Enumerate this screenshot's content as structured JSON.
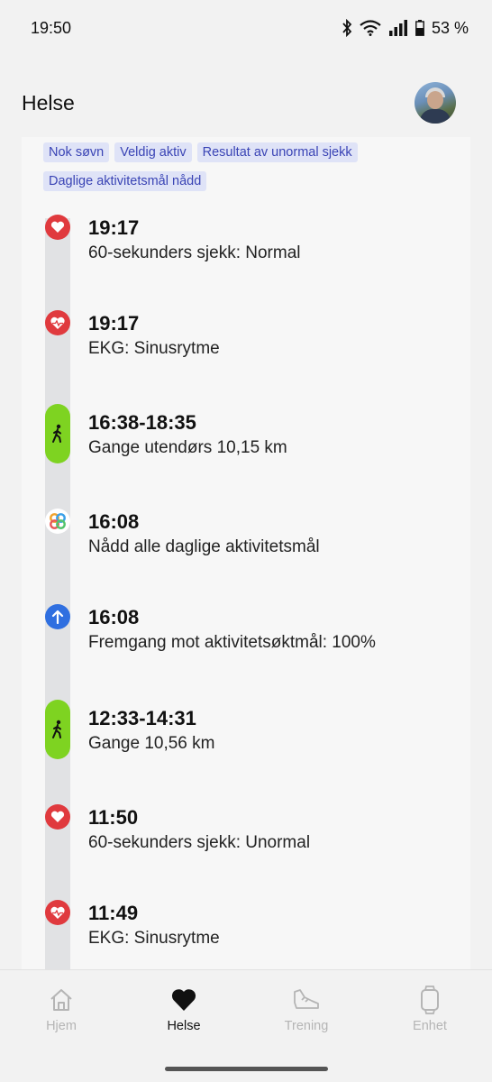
{
  "status_bar": {
    "time": "19:50",
    "battery": "53 %",
    "icons": [
      "bluetooth-icon",
      "wifi-icon",
      "signal-icon",
      "battery-icon"
    ]
  },
  "header": {
    "title": "Helse",
    "avatar": "avatar"
  },
  "tags": [
    "Nok søvn",
    "Veldig aktiv",
    "Resultat av unormal sjekk",
    "Daglige aktivitetsmål nådd"
  ],
  "timeline": [
    {
      "time": "19:17",
      "description": "60-sekunders sjekk: Normal",
      "icon": "heart-icon"
    },
    {
      "time": "19:17",
      "description": "EKG: Sinusrytme",
      "icon": "ecg-heart-icon"
    },
    {
      "time": "16:38-18:35",
      "description": "Gange utendørs 10,15 km",
      "icon": "walk-icon"
    },
    {
      "time": "16:08",
      "description": "Nådd alle daglige aktivitetsmål",
      "icon": "activity-rings-icon"
    },
    {
      "time": "16:08",
      "description": "Fremgang mot aktivitetsøktmål: 100%",
      "icon": "arrow-up-icon"
    },
    {
      "time": "12:33-14:31",
      "description": "Gange 10,56 km",
      "icon": "walk-icon"
    },
    {
      "time": "11:50",
      "description": "60-sekunders sjekk: Unormal",
      "icon": "heart-icon"
    },
    {
      "time": "11:49",
      "description": "EKG: Sinusrytme",
      "icon": "ecg-heart-icon"
    }
  ],
  "bottom_nav": [
    {
      "label": "Hjem",
      "icon": "home-icon",
      "active": false
    },
    {
      "label": "Helse",
      "icon": "heart-icon",
      "active": true
    },
    {
      "label": "Trening",
      "icon": "shoe-icon",
      "active": false
    },
    {
      "label": "Enhet",
      "icon": "watch-icon",
      "active": false
    }
  ],
  "colors": {
    "heart_red": "#e03a3e",
    "progress_blue": "#2f6fe0",
    "walk_green": "#7ed321",
    "tag_background": "#dfe3f7",
    "tag_text": "#3a44b5"
  }
}
